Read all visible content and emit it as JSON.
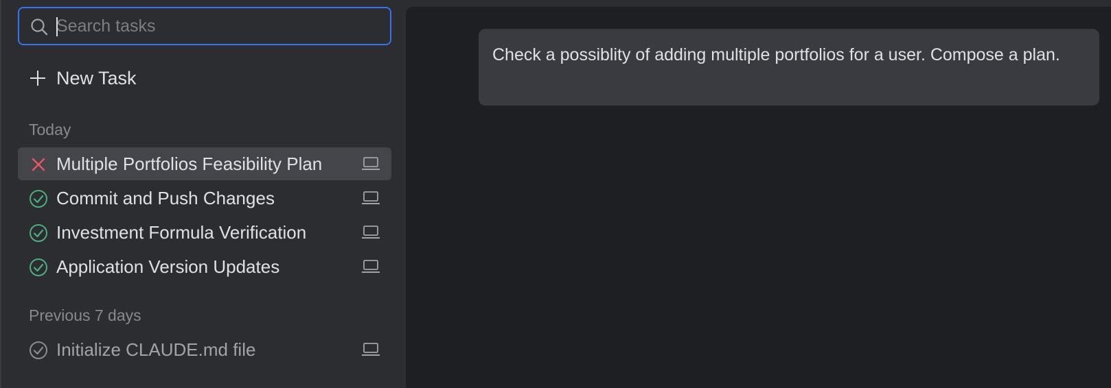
{
  "search": {
    "placeholder": "Search tasks",
    "value": ""
  },
  "new_task": {
    "label": "New Task",
    "icon": "plus-icon"
  },
  "sections": {
    "today": {
      "title": "Today",
      "tasks": [
        {
          "label": "Multiple Portfolios Feasibility Plan",
          "status": "failed",
          "status_icon": "x-icon",
          "environment_icon": "laptop-icon",
          "selected": true
        },
        {
          "label": "Commit and Push Changes",
          "status": "completed",
          "status_icon": "check-circle-icon",
          "environment_icon": "laptop-icon",
          "selected": false
        },
        {
          "label": "Investment Formula Verification",
          "status": "completed",
          "status_icon": "check-circle-icon",
          "environment_icon": "laptop-icon",
          "selected": false
        },
        {
          "label": "Application Version Updates",
          "status": "completed",
          "status_icon": "check-circle-icon",
          "environment_icon": "laptop-icon",
          "selected": false
        }
      ]
    },
    "previous_7_days": {
      "title": "Previous 7 days",
      "tasks": [
        {
          "label": "Initialize CLAUDE.md file",
          "status": "completed",
          "status_icon": "check-circle-icon",
          "environment_icon": "laptop-icon",
          "selected": false
        }
      ]
    }
  },
  "chat": {
    "messages": [
      {
        "role": "user",
        "text": "Check a possiblity of adding multiple portfolios for a user. Compose a plan."
      }
    ]
  },
  "colors": {
    "sidebar_bg": "#2b2d30",
    "main_bg": "#1e1f22",
    "accent_focus": "#3574f0",
    "failed_red": "#e55765",
    "success_green": "#4caf80",
    "selected_row": "#43454a",
    "message_bg": "#393b40"
  }
}
